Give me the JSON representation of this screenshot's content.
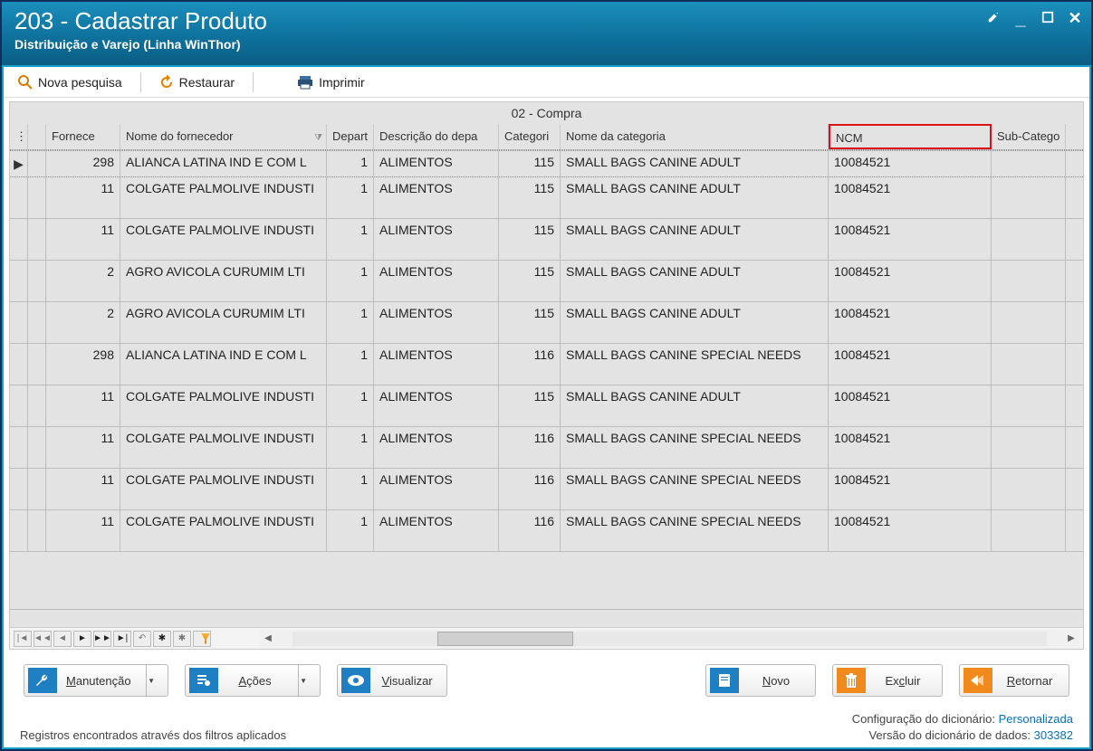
{
  "window": {
    "title": "203 - Cadastrar  Produto",
    "subtitle": "Distribuição e Varejo (Linha WinThor)"
  },
  "toolbar": {
    "search_label": "Nova pesquisa",
    "restore_label": "Restaurar",
    "print_label": "Imprimir"
  },
  "grid": {
    "band_title": "02 - Compra",
    "columns": {
      "fornecedor": "Fornece",
      "nome_fornecedor": "Nome do fornecedor",
      "departamento": "Depart",
      "desc_departamento": "Descrição do depa",
      "categoria": "Categori",
      "nome_categoria": "Nome da categoria",
      "ncm": "NCM",
      "sub_categoria": "Sub-Catego"
    },
    "rows": [
      {
        "fornecedor": "298",
        "nome": "ALIANCA LATINA IND E COM L",
        "dept": "1",
        "ddesc": "ALIMENTOS",
        "cat": "115",
        "ncat": "SMALL BAGS CANINE ADULT",
        "ncm": "10084521"
      },
      {
        "fornecedor": "11",
        "nome": "COLGATE PALMOLIVE INDUSTI",
        "dept": "1",
        "ddesc": "ALIMENTOS",
        "cat": "115",
        "ncat": "SMALL BAGS CANINE ADULT",
        "ncm": "10084521"
      },
      {
        "fornecedor": "11",
        "nome": "COLGATE PALMOLIVE INDUSTI",
        "dept": "1",
        "ddesc": "ALIMENTOS",
        "cat": "115",
        "ncat": "SMALL BAGS CANINE ADULT",
        "ncm": "10084521"
      },
      {
        "fornecedor": "2",
        "nome": "AGRO AVICOLA CURUMIM LTI",
        "dept": "1",
        "ddesc": "ALIMENTOS",
        "cat": "115",
        "ncat": "SMALL BAGS CANINE ADULT",
        "ncm": "10084521"
      },
      {
        "fornecedor": "2",
        "nome": "AGRO AVICOLA CURUMIM LTI",
        "dept": "1",
        "ddesc": "ALIMENTOS",
        "cat": "115",
        "ncat": "SMALL BAGS CANINE ADULT",
        "ncm": "10084521"
      },
      {
        "fornecedor": "298",
        "nome": "ALIANCA LATINA IND E COM L",
        "dept": "1",
        "ddesc": "ALIMENTOS",
        "cat": "116",
        "ncat": "SMALL BAGS CANINE SPECIAL NEEDS",
        "ncm": "10084521"
      },
      {
        "fornecedor": "11",
        "nome": "COLGATE PALMOLIVE INDUSTI",
        "dept": "1",
        "ddesc": "ALIMENTOS",
        "cat": "115",
        "ncat": "SMALL BAGS CANINE ADULT",
        "ncm": "10084521"
      },
      {
        "fornecedor": "11",
        "nome": "COLGATE PALMOLIVE INDUSTI",
        "dept": "1",
        "ddesc": "ALIMENTOS",
        "cat": "116",
        "ncat": "SMALL BAGS CANINE SPECIAL NEEDS",
        "ncm": "10084521"
      },
      {
        "fornecedor": "11",
        "nome": "COLGATE PALMOLIVE INDUSTI",
        "dept": "1",
        "ddesc": "ALIMENTOS",
        "cat": "116",
        "ncat": "SMALL BAGS CANINE SPECIAL NEEDS",
        "ncm": "10084521"
      },
      {
        "fornecedor": "11",
        "nome": "COLGATE PALMOLIVE INDUSTI",
        "dept": "1",
        "ddesc": "ALIMENTOS",
        "cat": "116",
        "ncat": "SMALL BAGS CANINE SPECIAL NEEDS",
        "ncm": "10084521"
      }
    ]
  },
  "buttons": {
    "manutencao": "Manutenção",
    "acoes": "Ações",
    "visualizar": "Visualizar",
    "novo": "Novo",
    "excluir": "Excluir",
    "retornar": "Retornar"
  },
  "status": {
    "message": "Registros encontrados através dos filtros aplicados",
    "config_label": "Configuração do dicionário:",
    "config_value": "Personalizada",
    "version_label": "Versão do dicionário de dados:",
    "version_value": "303382"
  }
}
